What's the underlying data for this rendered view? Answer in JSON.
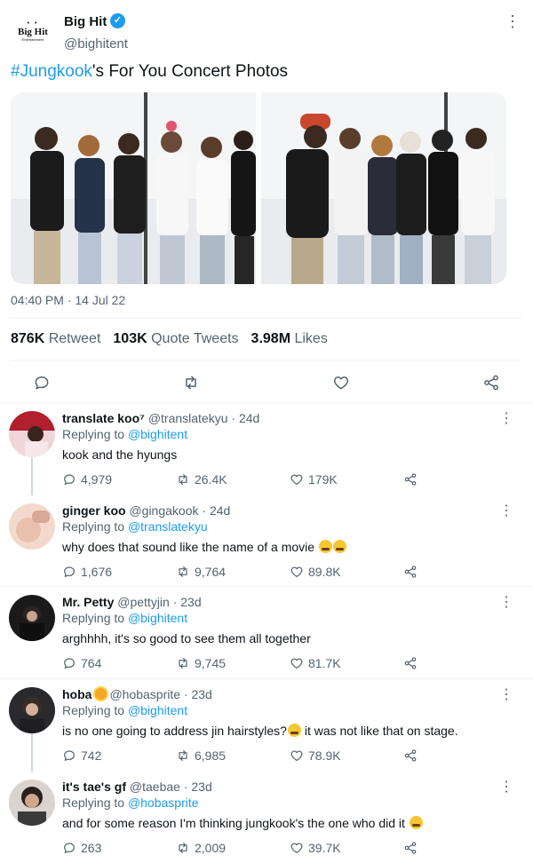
{
  "tweet": {
    "logo_text": "Big Hit",
    "logo_sub": "Entertainment",
    "author_name": "Big Hit",
    "author_handle": "@bighitent",
    "text_hashtag": "#Jungkook",
    "text_rest": "'s For You Concert Photos",
    "timestamp": "04:40 PM · 14 Jul 22",
    "stats": {
      "retweets_value": "876K",
      "retweets_label": "Retweet",
      "quotes_value": "103K",
      "quotes_label": "Quote Tweets",
      "likes_value": "3.98M",
      "likes_label": "Likes"
    }
  },
  "colors": {
    "accent": "#1d9bf0",
    "text": "#0f1419",
    "muted": "#536471",
    "divider": "#eff3f4"
  },
  "icons": [
    "verified-badge-icon",
    "more-icon",
    "reply-icon",
    "retweet-icon",
    "like-icon",
    "share-icon",
    "sunflower-emoji-icon",
    "crying-emoji-icon"
  ],
  "replies": [
    {
      "name": "translate koo⁷",
      "handle": "@translatekyu",
      "time": "· 24d",
      "replying_label": "Replying to",
      "replying_to": "@bighitent",
      "text": "kook and the hyungs",
      "replies": "4,979",
      "retweets": "26.4K",
      "likes": "179K"
    },
    {
      "name": "ginger koo",
      "handle": "@gingakook",
      "time": "· 24d",
      "replying_label": "Replying to",
      "replying_to": "@translatekyu",
      "text": "why does that sound like the name of a movie",
      "replies": "1,676",
      "retweets": "9,764",
      "likes": "89.8K"
    },
    {
      "name": "Mr. Petty",
      "handle": "@pettyjin",
      "time": "· 23d",
      "replying_label": "Replying to",
      "replying_to": "@bighitent",
      "text": "arghhhh, it's so good to see them all together",
      "replies": "764",
      "retweets": "9,745",
      "likes": "81.7K"
    },
    {
      "name": "hoba",
      "handle": "@hobasprite",
      "time": "· 23d",
      "replying_label": "Replying to",
      "replying_to": "@bighitent",
      "text_before": "is no one going to address jin hairstyles?",
      "text_after": " it was not like that on stage.",
      "replies": "742",
      "retweets": "6,985",
      "likes": "78.9K"
    },
    {
      "name": "it's tae's gf",
      "handle": "@taebae",
      "time": "· 23d",
      "replying_label": "Replying to",
      "replying_to": "@hobasprite",
      "text": "and for some reason I'm thinking jungkook's the one who did it",
      "replies": "263",
      "retweets": "2,009",
      "likes": "39.7K"
    }
  ]
}
